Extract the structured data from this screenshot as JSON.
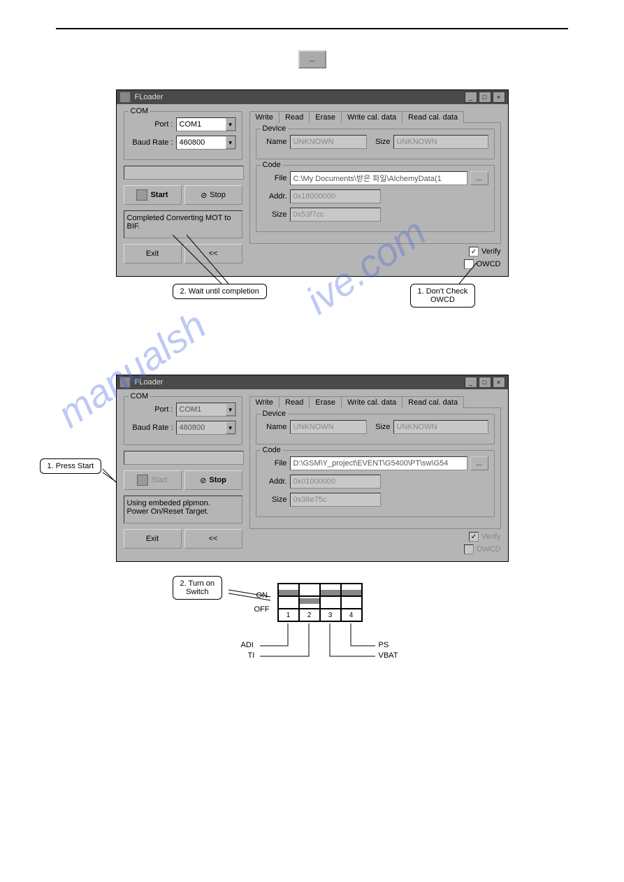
{
  "top_button_label": "...",
  "window1": {
    "title": "FLoader",
    "com": {
      "legend": "COM",
      "port_label": "Port :",
      "port_value": "COM1",
      "baud_label": "Baud Rate :",
      "baud_value": "460800"
    },
    "start_label": "Start",
    "stop_label": "Stop",
    "status": "Completed Converting MOT to BIF.",
    "exit_label": "Exit",
    "back_label": "<<",
    "tabs": [
      "Write",
      "Read",
      "Erase",
      "Write cal. data",
      "Read cal. data"
    ],
    "device": {
      "legend": "Device",
      "name_label": "Name",
      "name_value": "UNKNOWN",
      "size_label": "Size",
      "size_value": "UNKNOWN"
    },
    "code": {
      "legend": "Code",
      "file_label": "File",
      "file_value": "C:\\My Documents\\받은 파일\\AlchemyData(1",
      "browse": "...",
      "addr_label": "Addr.",
      "addr_value": "0x18000000",
      "size_label": "Size",
      "size_value": "0x53f7cc"
    },
    "verify_label": "Verify",
    "verify_checked": true,
    "owcd_label": "OWCD",
    "owcd_checked": false
  },
  "callouts1": {
    "left": "2. Wait until completion",
    "right": "1. Don't Check\nOWCD"
  },
  "window2": {
    "title": "FLoader",
    "com": {
      "legend": "COM",
      "port_label": "Port :",
      "port_value": "COM1",
      "baud_label": "Baud Rate :",
      "baud_value": "460800"
    },
    "start_label": "Start",
    "stop_label": "Stop",
    "status": "Using embeded plpmon.\nPower On/Reset Target.",
    "exit_label": "Exit",
    "back_label": "<<",
    "tabs": [
      "Write",
      "Read",
      "Erase",
      "Write cal. data",
      "Read cal. data"
    ],
    "device": {
      "legend": "Device",
      "name_label": "Name",
      "name_value": "UNKNOWN",
      "size_label": "Size",
      "size_value": "UNKNOWN"
    },
    "code": {
      "legend": "Code",
      "file_label": "File",
      "file_value": "D:\\GSM\\Y_project\\EVENT\\G5400\\PT\\sw\\G54",
      "browse": "...",
      "addr_label": "Addr.",
      "addr_value": "0x01000000",
      "size_label": "Size",
      "size_value": "0x36e75c"
    },
    "verify_label": "Verify",
    "owcd_label": "OWCD"
  },
  "callouts2": {
    "left": "1. Press Start",
    "bottom": "2. Turn on\nSwitch"
  },
  "switch": {
    "on": "ON",
    "off": "OFF",
    "nums": [
      "1",
      "2",
      "3",
      "4"
    ],
    "adi": "ADI",
    "ti": "TI",
    "ps": "PS",
    "vbat": "VBAT"
  },
  "watermark": "manualshive.com"
}
